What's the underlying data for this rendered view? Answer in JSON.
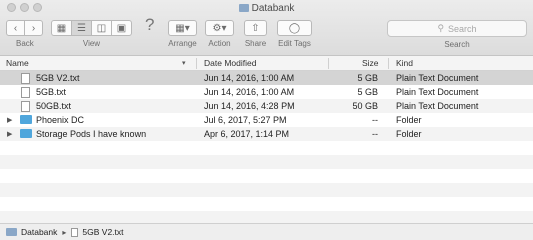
{
  "window": {
    "title": "Databank"
  },
  "toolbar": {
    "back_label": "Back",
    "view_label": "View",
    "arrange_label": "Arrange",
    "action_label": "Action",
    "share_label": "Share",
    "edit_tags_label": "Edit Tags",
    "search_label": "Search",
    "search_placeholder": "Search",
    "help_glyph": "?"
  },
  "columns": {
    "name": "Name",
    "date": "Date Modified",
    "size": "Size",
    "kind": "Kind"
  },
  "files": [
    {
      "name": "5GB V2.txt",
      "date": "Jun 14, 2016, 1:00 AM",
      "size": "5 GB",
      "kind": "Plain Text Document",
      "type": "doc",
      "selected": true
    },
    {
      "name": "5GB.txt",
      "date": "Jun 14, 2016, 1:00 AM",
      "size": "5 GB",
      "kind": "Plain Text Document",
      "type": "doc"
    },
    {
      "name": "50GB.txt",
      "date": "Jun 14, 2016, 4:28 PM",
      "size": "50 GB",
      "kind": "Plain Text Document",
      "type": "doc"
    },
    {
      "name": "Phoenix DC",
      "date": "Jul 6, 2017, 5:27 PM",
      "size": "--",
      "kind": "Folder",
      "type": "folder"
    },
    {
      "name": "Storage Pods I have known",
      "date": "Apr 6, 2017, 1:14 PM",
      "size": "--",
      "kind": "Folder",
      "type": "folder"
    }
  ],
  "pathbar": {
    "items": [
      "Databank",
      "5GB V2.txt"
    ]
  },
  "colors": {
    "selection": "#d4d4d4",
    "folder": "#4fa6dc",
    "stripe": "#f3f3f3"
  }
}
